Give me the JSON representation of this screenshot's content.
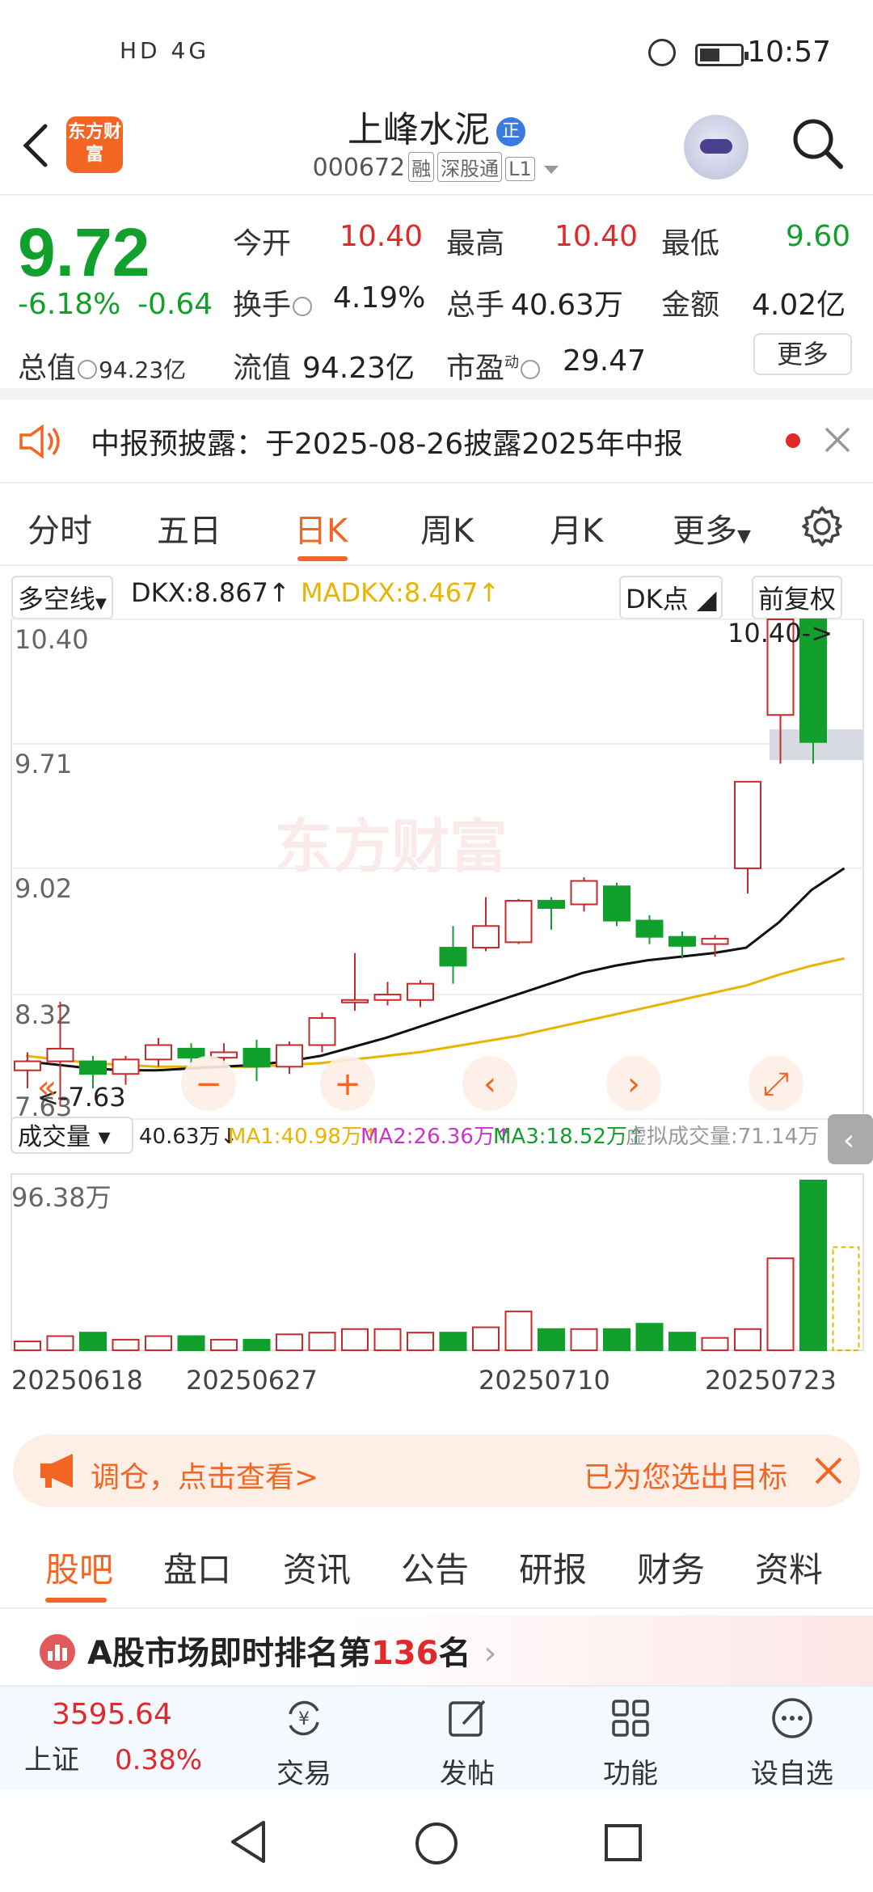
{
  "status_bar": {
    "time": "10:57",
    "left_icons": "HD 4G"
  },
  "header": {
    "logo_text": "东方财富",
    "stock_name": "上峰水泥",
    "name_badge": "正",
    "stock_code": "000672",
    "tags": [
      "融",
      "深股通",
      "L1"
    ]
  },
  "quote": {
    "price": "9.72",
    "change_pct": "-6.18%",
    "change": "-0.64",
    "market_cap_label": "总值",
    "market_cap": "94.23亿",
    "fields": {
      "open_label": "今开",
      "open": "10.40",
      "high_label": "最高",
      "high": "10.40",
      "low_label": "最低",
      "low": "9.60",
      "turnover_label": "换手",
      "turnover": "4.19%",
      "volume_label": "总手",
      "volume": "40.63万",
      "amount_label": "金额",
      "amount": "4.02亿",
      "float_cap_label": "流值",
      "float_cap": "94.23亿",
      "pe_label": "市盈",
      "pe_sup": "动",
      "pe": "29.47"
    },
    "more": "更多"
  },
  "notice": {
    "text": "中报预披露：于2025-08-26披露2025年中报"
  },
  "kline_tabs": {
    "items": [
      "分时",
      "五日",
      "日K",
      "周K",
      "月K",
      "更多"
    ],
    "active": "日K"
  },
  "indicator_bar": {
    "selector": "多空线",
    "dkx": "DKX:8.867",
    "madkx": "MADKX:8.467",
    "dk_point": "DK点",
    "adjust": "前复权"
  },
  "volume_bar": {
    "selector": "成交量",
    "vol": "40.63万",
    "ma1": "MA1:40.98万",
    "ma2": "MA2:26.36万",
    "ma3": "MA3:18.52万",
    "virtual": "虚拟成交量:71.14万",
    "max_label": "96.38万"
  },
  "chart_data": {
    "type": "candlestick",
    "y_ticks": [
      "10.40",
      "9.71",
      "9.02",
      "8.32",
      "7.63"
    ],
    "ylim": [
      7.63,
      10.4
    ],
    "high_marker": "10.40->",
    "low_marker": "<-7.63",
    "dates": [
      "20250618",
      "20250627",
      "20250710",
      "20250723"
    ],
    "candles": [
      {
        "o": 7.9,
        "h": 8.0,
        "l": 7.8,
        "c": 7.95
      },
      {
        "o": 7.95,
        "h": 8.28,
        "l": 7.7,
        "c": 8.02
      },
      {
        "o": 7.95,
        "h": 7.98,
        "l": 7.8,
        "c": 7.88
      },
      {
        "o": 7.88,
        "h": 7.98,
        "l": 7.82,
        "c": 7.96
      },
      {
        "o": 7.96,
        "h": 8.08,
        "l": 7.92,
        "c": 8.04
      },
      {
        "o": 8.02,
        "h": 8.05,
        "l": 7.92,
        "c": 7.97
      },
      {
        "o": 7.97,
        "h": 8.05,
        "l": 7.93,
        "c": 8.0
      },
      {
        "o": 8.02,
        "h": 8.07,
        "l": 7.84,
        "c": 7.92
      },
      {
        "o": 7.92,
        "h": 8.06,
        "l": 7.88,
        "c": 8.04
      },
      {
        "o": 8.04,
        "h": 8.22,
        "l": 8.0,
        "c": 8.19
      },
      {
        "o": 8.29,
        "h": 8.55,
        "l": 8.23,
        "c": 8.29
      },
      {
        "o": 8.29,
        "h": 8.39,
        "l": 8.26,
        "c": 8.32
      },
      {
        "o": 8.29,
        "h": 8.4,
        "l": 8.25,
        "c": 8.38
      },
      {
        "o": 8.58,
        "h": 8.7,
        "l": 8.38,
        "c": 8.48
      },
      {
        "o": 8.58,
        "h": 8.86,
        "l": 8.56,
        "c": 8.7
      },
      {
        "o": 8.61,
        "h": 8.85,
        "l": 8.6,
        "c": 8.84
      },
      {
        "o": 8.84,
        "h": 8.86,
        "l": 8.68,
        "c": 8.8
      },
      {
        "o": 8.82,
        "h": 8.97,
        "l": 8.78,
        "c": 8.95
      },
      {
        "o": 8.92,
        "h": 8.94,
        "l": 8.7,
        "c": 8.73
      },
      {
        "o": 8.73,
        "h": 8.76,
        "l": 8.6,
        "c": 8.64
      },
      {
        "o": 8.64,
        "h": 8.67,
        "l": 8.52,
        "c": 8.59
      },
      {
        "o": 8.6,
        "h": 8.65,
        "l": 8.53,
        "c": 8.63
      },
      {
        "o": 9.02,
        "h": 9.5,
        "l": 8.88,
        "c": 9.5
      },
      {
        "o": 9.87,
        "h": 10.4,
        "l": 9.6,
        "c": 10.4
      },
      {
        "o": 10.4,
        "h": 10.4,
        "l": 9.6,
        "c": 9.72
      }
    ],
    "volumes": [
      5,
      8,
      10,
      6,
      8,
      8,
      6,
      6,
      9,
      10,
      12,
      12,
      10,
      10,
      13,
      22,
      12,
      12,
      12,
      15,
      10,
      7,
      12,
      52,
      96,
      40
    ],
    "ma_short": [
      7.95,
      7.93,
      7.91,
      7.9,
      7.9,
      7.91,
      7.92,
      7.93,
      7.95,
      7.98,
      8.03,
      8.08,
      8.14,
      8.2,
      8.26,
      8.32,
      8.38,
      8.44,
      8.48,
      8.51,
      8.53,
      8.55,
      8.58,
      8.72,
      8.9,
      9.02
    ],
    "ma_long": [
      7.98,
      7.96,
      7.94,
      7.93,
      7.92,
      7.92,
      7.92,
      7.92,
      7.93,
      7.94,
      7.96,
      7.98,
      8.0,
      8.03,
      8.06,
      8.09,
      8.13,
      8.17,
      8.21,
      8.25,
      8.29,
      8.33,
      8.37,
      8.43,
      8.48,
      8.52
    ]
  },
  "banner": {
    "left": "调仓，点击查看>",
    "right": "已为您选出目标"
  },
  "content_tabs": {
    "items": [
      "股吧",
      "盘口",
      "资讯",
      "公告",
      "研报",
      "财务",
      "资料"
    ],
    "active": "股吧"
  },
  "rank": {
    "prefix": "A股市场即时排名第",
    "rank": "136",
    "suffix": "名"
  },
  "bottom_nav": {
    "index_value": "3595.64",
    "index_name": "上证",
    "index_change": "0.38%",
    "items": [
      "交易",
      "发帖",
      "功能",
      "设自选"
    ]
  }
}
